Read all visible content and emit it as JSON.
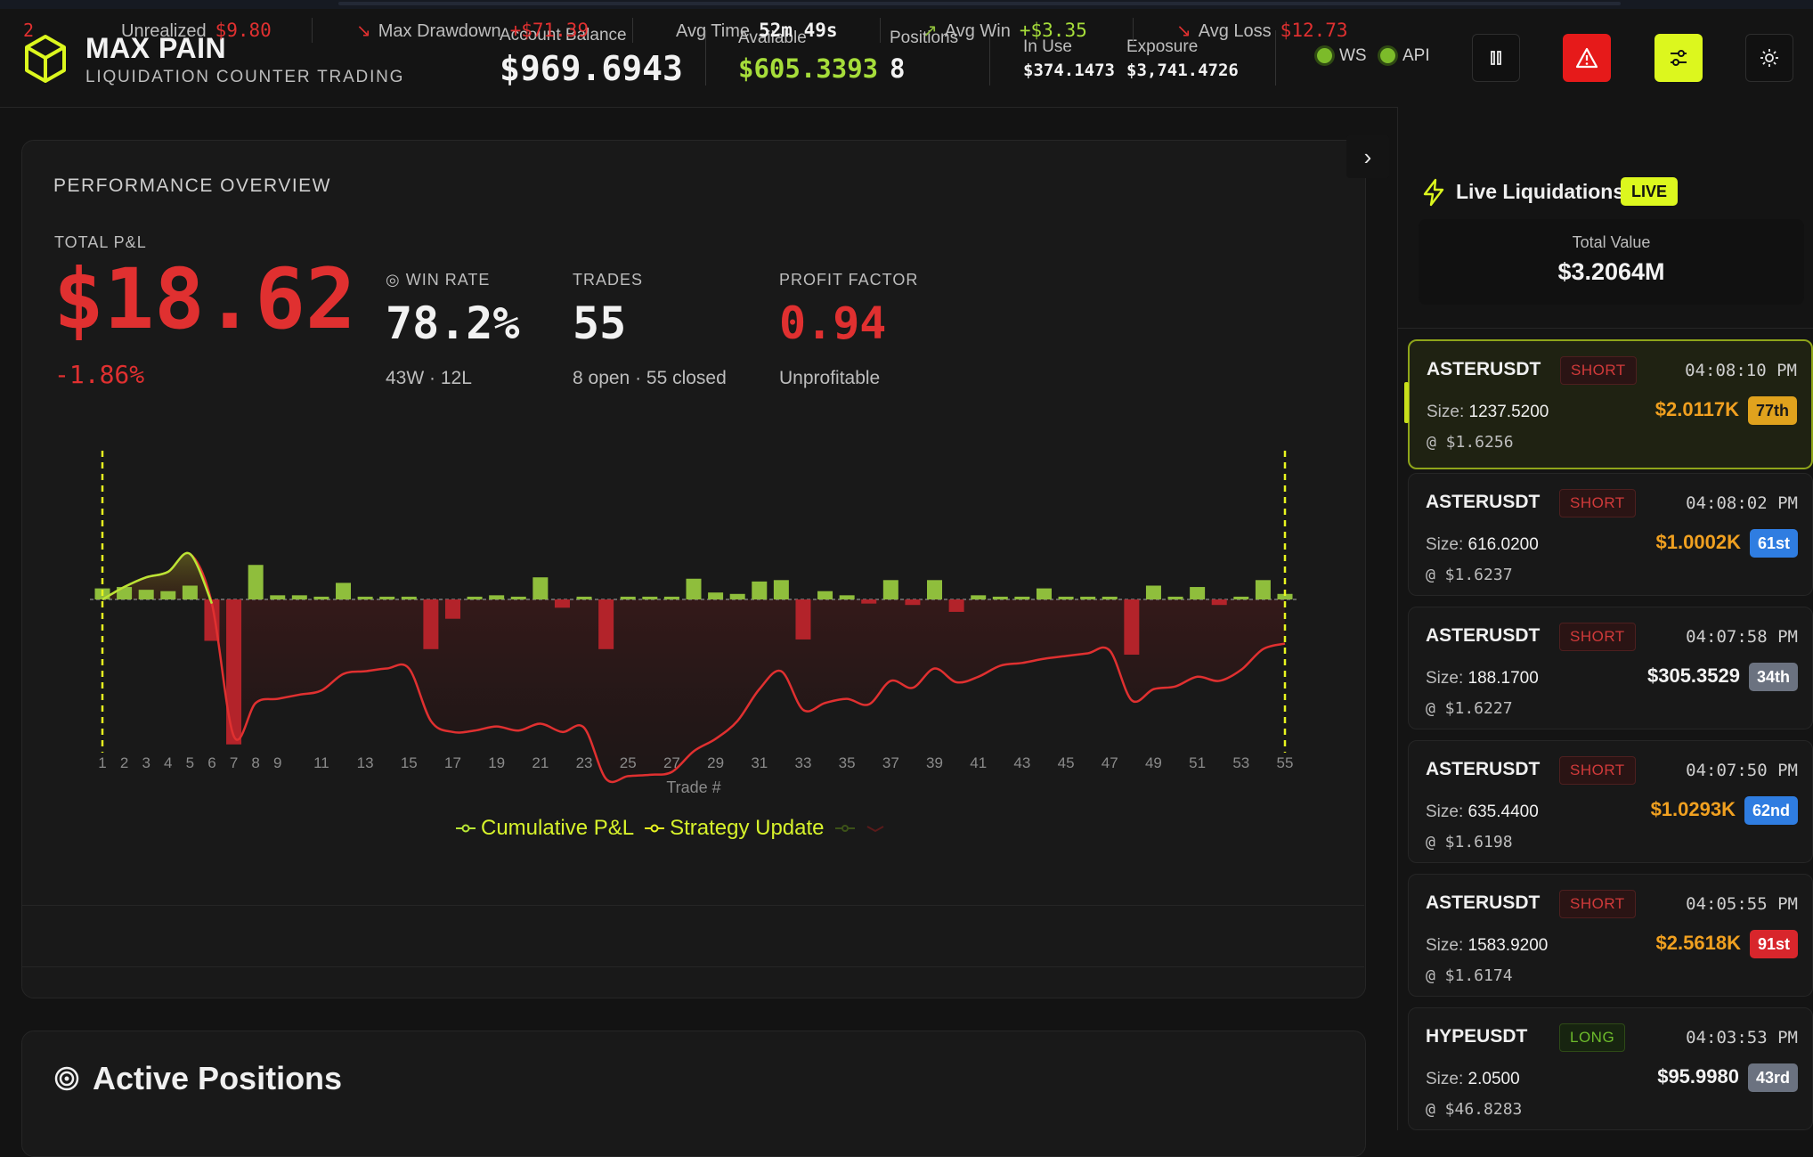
{
  "brand": {
    "title": "MAX PAIN",
    "subtitle": "LIQUIDATION COUNTER TRADING"
  },
  "header": {
    "account_balance_label": "Account Balance",
    "account_balance": "$969.6943",
    "available_label": "Available",
    "available": "$605.3393",
    "positions_label": "Positions",
    "positions": "8",
    "in_use_label": "In Use",
    "in_use": "$374.1473",
    "exposure_label": "Exposure",
    "exposure": "$3,741.4726",
    "ws_label": "WS",
    "api_label": "API",
    "buttons": [
      "pause-icon",
      "alert-triangle-icon",
      "sliders-icon",
      "sun-icon"
    ]
  },
  "performance": {
    "title": "PERFORMANCE OVERVIEW",
    "total_pnl_label": "TOTAL P&L",
    "total_pnl": "$18.62",
    "total_pnl_pct": "-1.86%",
    "win_rate_label": "WIN RATE",
    "win_rate": "78.2%",
    "win_rate_sub": "43W · 12L",
    "trades_label": "TRADES",
    "trades": "55",
    "trades_sub": "8 open · 55 closed",
    "profit_factor_label": "PROFIT FACTOR",
    "profit_factor": "0.94",
    "profit_factor_sub": "Unprofitable"
  },
  "chart_data": {
    "type": "bar",
    "xlabel": "Trade #",
    "x_ticks": [
      1,
      2,
      3,
      4,
      5,
      6,
      7,
      8,
      9,
      11,
      13,
      15,
      17,
      19,
      21,
      23,
      25,
      27,
      29,
      31,
      33,
      35,
      37,
      39,
      41,
      43,
      45,
      47,
      49,
      51,
      53,
      55
    ],
    "x": [
      1,
      2,
      3,
      4,
      5,
      6,
      7,
      8,
      9,
      10,
      11,
      12,
      13,
      14,
      15,
      16,
      17,
      18,
      19,
      20,
      21,
      22,
      23,
      24,
      25,
      26,
      27,
      28,
      29,
      30,
      31,
      32,
      33,
      34,
      35,
      36,
      37,
      38,
      39,
      40,
      41,
      42,
      43,
      44,
      45,
      46,
      47,
      48,
      49,
      50,
      51,
      52,
      53,
      54,
      55
    ],
    "trade_pnl": [
      0.8,
      0.9,
      0.7,
      0.6,
      1.0,
      -3.0,
      -10.5,
      2.5,
      0.3,
      0.3,
      0.2,
      1.2,
      0.2,
      0.2,
      0.2,
      -3.6,
      -1.4,
      0.2,
      0.3,
      0.2,
      1.6,
      -0.6,
      0.2,
      -3.6,
      0.2,
      0.2,
      0.2,
      1.5,
      0.5,
      0.4,
      1.3,
      1.4,
      -2.9,
      0.6,
      0.3,
      -0.3,
      1.4,
      -0.4,
      1.4,
      -0.9,
      0.3,
      0.2,
      0.2,
      0.8,
      0.2,
      0.2,
      0.2,
      -4.0,
      1.0,
      0.2,
      0.9,
      -0.4,
      0.2,
      1.4,
      0.4
    ],
    "series": [
      {
        "name": "Cumulative P&L",
        "values": [
          0.0,
          0.9,
          1.6,
          2.0,
          3.3,
          -0.3,
          -9.9,
          -7.5,
          -7.2,
          -6.9,
          -6.6,
          -5.4,
          -5.2,
          -5.0,
          -5.0,
          -8.8,
          -9.6,
          -9.5,
          -9.2,
          -9.5,
          -9.0,
          -9.6,
          -9.3,
          -13.0,
          -12.8,
          -12.7,
          -12.5,
          -11.0,
          -10.1,
          -8.8,
          -6.5,
          -5.2,
          -8.0,
          -7.5,
          -7.2,
          -7.6,
          -5.9,
          -6.4,
          -5.0,
          -6.0,
          -5.6,
          -4.8,
          -4.6,
          -4.3,
          -4.1,
          -3.9,
          -3.7,
          -7.3,
          -6.5,
          -6.3,
          -5.6,
          -5.9,
          -5.1,
          -3.6,
          -3.2
        ]
      },
      {
        "name": "Strategy Update",
        "values": [
          1,
          55
        ]
      }
    ],
    "legend": [
      "Cumulative P&L",
      "Strategy Update"
    ],
    "legend_position": "bottom-center",
    "colors": {
      "profit": "#8fbe3c",
      "loss": "#b3232a",
      "cum_positive": "#b8e635",
      "cum_negative": "#e03030",
      "update_line": "#e8f51f"
    }
  },
  "stats_bar": {
    "partial_value": "2",
    "unrealized_label": "Unrealized",
    "unrealized": "$9.80",
    "max_drawdown_label": "Max Drawdown",
    "max_drawdown": "+$71.39",
    "avg_time_label": "Avg Time",
    "avg_time": "52m 49s",
    "avg_win_label": "Avg Win",
    "avg_win": "+$3.35",
    "avg_loss_label": "Avg Loss",
    "avg_loss": "$12.73"
  },
  "active_positions": {
    "title": "Active Positions"
  },
  "live": {
    "title": "Live Liquidations",
    "badge": "LIVE",
    "total_value_label": "Total Value",
    "total_value": "$3.2064M",
    "size_label": "Size:",
    "items": [
      {
        "symbol": "ASTERUSDT",
        "side": "SHORT",
        "time": "04:08:10 PM",
        "size": "1237.5200",
        "price": "@ $1.6256",
        "amount": "$2.0117K",
        "rank": "77th",
        "amount_color": "#f0a020",
        "rank_bg": "#e0a21d",
        "rank_fg": "#1a1a1a"
      },
      {
        "symbol": "ASTERUSDT",
        "side": "SHORT",
        "time": "04:08:02 PM",
        "size": "616.0200",
        "price": "@ $1.6237",
        "amount": "$1.0002K",
        "rank": "61st",
        "amount_color": "#f0a020",
        "rank_bg": "#2f7de1",
        "rank_fg": "#ffffff"
      },
      {
        "symbol": "ASTERUSDT",
        "side": "SHORT",
        "time": "04:07:58 PM",
        "size": "188.1700",
        "price": "@ $1.6227",
        "amount": "$305.3529",
        "rank": "34th",
        "amount_color": "#f2f2f2",
        "rank_bg": "#6b7280",
        "rank_fg": "#ffffff"
      },
      {
        "symbol": "ASTERUSDT",
        "side": "SHORT",
        "time": "04:07:50 PM",
        "size": "635.4400",
        "price": "@ $1.6198",
        "amount": "$1.0293K",
        "rank": "62nd",
        "amount_color": "#f0a020",
        "rank_bg": "#2f7de1",
        "rank_fg": "#ffffff"
      },
      {
        "symbol": "ASTERUSDT",
        "side": "SHORT",
        "time": "04:05:55 PM",
        "size": "1583.9200",
        "price": "@ $1.6174",
        "amount": "$2.5618K",
        "rank": "91st",
        "amount_color": "#f0a020",
        "rank_bg": "#d8262c",
        "rank_fg": "#ffffff"
      },
      {
        "symbol": "HYPEUSDT",
        "side": "LONG",
        "time": "04:03:53 PM",
        "size": "2.0500",
        "price": "@ $46.8283",
        "amount": "$95.9980",
        "rank": "43rd",
        "amount_color": "#f2f2f2",
        "rank_bg": "#6b7280",
        "rank_fg": "#ffffff"
      }
    ]
  }
}
